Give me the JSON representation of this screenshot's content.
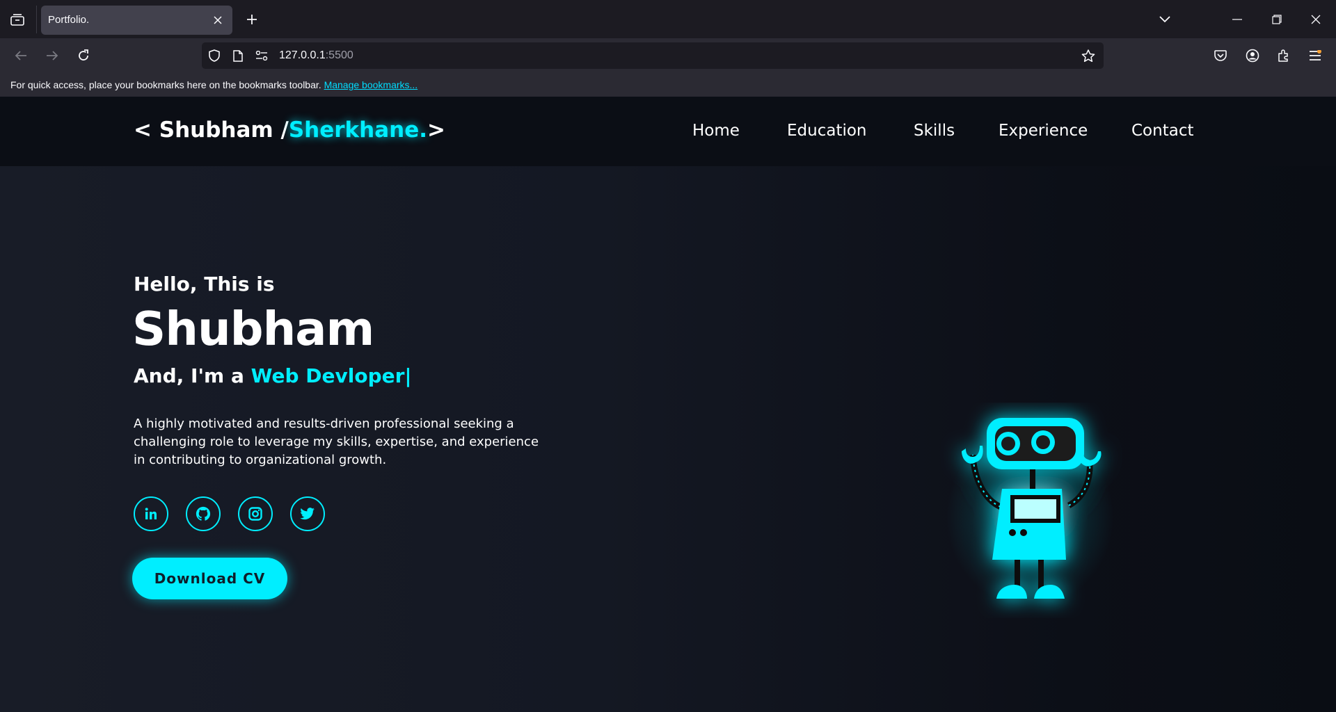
{
  "browser": {
    "tab_title": "Portfolio.",
    "url_host": "127.0.0.1",
    "url_port": ":5500",
    "bookmarks_message": "For quick access, place your bookmarks here on the bookmarks toolbar.",
    "bookmarks_link": "Manage bookmarks..."
  },
  "site": {
    "logo_prefix": "< Shubham /",
    "logo_accent": "Sherkhane.",
    "logo_suffix": ">",
    "nav": [
      "Home",
      "Education",
      "Skills",
      "Experience",
      "Contact"
    ]
  },
  "hero": {
    "greeting": "Hello, This is",
    "name": "Shubham",
    "role_prefix": "And, I'm a ",
    "role_accent": "Web Devloper|",
    "description": "A highly motivated and results-driven professional seeking a challenging role to leverage my skills, expertise, and experience in contributing to organizational growth.",
    "socials": [
      "linkedin-icon",
      "github-icon",
      "instagram-icon",
      "twitter-icon"
    ],
    "cv_button": "Download CV"
  },
  "colors": {
    "accent": "#00eeff",
    "page_bg": "#141823",
    "header_bg": "#0b0e15"
  }
}
